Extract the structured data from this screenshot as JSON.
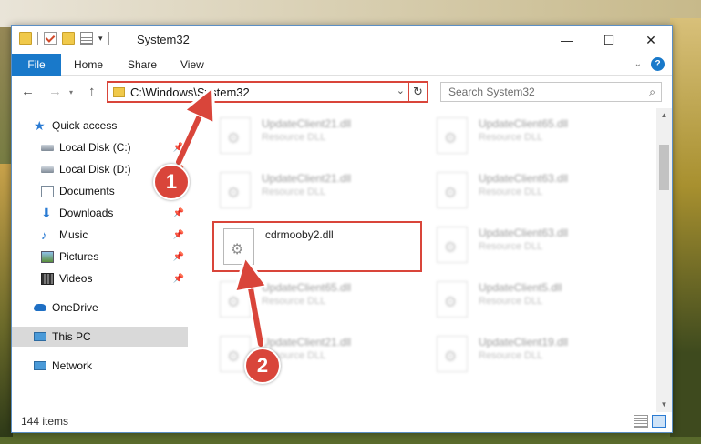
{
  "window": {
    "title": "System32",
    "minimize_icon": "minimize-icon",
    "maximize_icon": "maximize-icon",
    "close_icon": "close-icon"
  },
  "ribbon": {
    "tabs": [
      "File",
      "Home",
      "Share",
      "View"
    ]
  },
  "address": {
    "path": "C:\\Windows\\System32",
    "search_placeholder": "Search System32"
  },
  "nav": {
    "items": [
      {
        "label": "Quick access",
        "icon": "star-icon"
      },
      {
        "label": "Local Disk (C:)",
        "icon": "drive-icon",
        "pinned": true
      },
      {
        "label": "Local Disk (D:)",
        "icon": "drive-icon",
        "pinned": true
      },
      {
        "label": "Documents",
        "icon": "document-icon",
        "pinned": true
      },
      {
        "label": "Downloads",
        "icon": "download-icon",
        "pinned": true
      },
      {
        "label": "Music",
        "icon": "music-icon",
        "pinned": true
      },
      {
        "label": "Pictures",
        "icon": "pictures-icon",
        "pinned": true
      },
      {
        "label": "Videos",
        "icon": "videos-icon",
        "pinned": true
      },
      {
        "label": "OneDrive",
        "icon": "cloud-icon"
      },
      {
        "label": "This PC",
        "icon": "computer-icon",
        "selected": true
      },
      {
        "label": "Network",
        "icon": "network-icon"
      }
    ]
  },
  "files": {
    "left": [
      {
        "name": "UpdateClient21.dll",
        "type": "Resource DLL"
      },
      {
        "name": "UpdateClient21.dll",
        "type": "Resource DLL"
      },
      {
        "name": "cdrmooby2.dll",
        "type": ""
      },
      {
        "name": "UpdateClient65.dll",
        "type": "Resource DLL"
      },
      {
        "name": "UpdateClient21.dll",
        "type": "Resource DLL"
      }
    ],
    "right": [
      {
        "name": "UpdateClient65.dll",
        "type": "Resource DLL"
      },
      {
        "name": "UpdateClient63.dll",
        "type": "Resource DLL"
      },
      {
        "name": "UpdateClient63.dll",
        "type": "Resource DLL"
      },
      {
        "name": "UpdateClient5.dll",
        "type": "Resource DLL"
      },
      {
        "name": "UpdateClient19.dll",
        "type": "Resource DLL"
      }
    ]
  },
  "status": {
    "item_count": "144 items"
  },
  "annotations": {
    "step1": "1",
    "step2": "2",
    "color": "#d9453a"
  },
  "colors": {
    "accent": "#1979ca",
    "highlight_border": "#d9453a"
  }
}
